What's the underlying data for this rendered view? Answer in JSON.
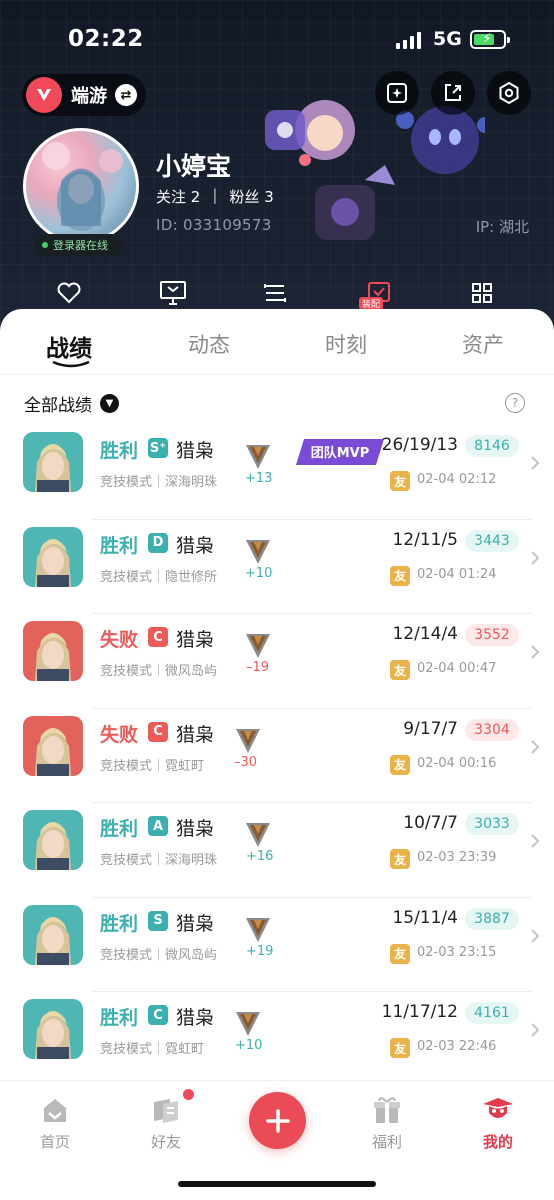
{
  "status": {
    "time": "02:22",
    "network": "5G"
  },
  "app": {
    "name": "端游"
  },
  "profile": {
    "name": "小婷宝",
    "follow_label": "关注",
    "follow_count": "2",
    "fans_label": "粉丝",
    "fans_count": "3",
    "id_text": "ID: 033109573",
    "ip_text": "IP: 湖北",
    "online_text": "登录器在线"
  },
  "quick": {
    "equip_tag": "装配"
  },
  "tabs": [
    "战绩",
    "动态",
    "时刻",
    "资产"
  ],
  "filter": {
    "label": "全部战绩",
    "help": "?"
  },
  "matches": [
    {
      "result": "胜利",
      "outcome": "win",
      "rank": "S⁺",
      "rank_color": "#3bb0ae",
      "hero": "猎枭",
      "mode": "竞技模式｜深海明珠",
      "delta": "+13",
      "kda": "26/19/13",
      "score": "8146",
      "date": "02-04 02:12",
      "mvp": "团队MVP"
    },
    {
      "result": "胜利",
      "outcome": "win",
      "rank": "D",
      "rank_color": "#3bb0ae",
      "hero": "猎枭",
      "mode": "竞技模式｜隐世修所",
      "delta": "+10",
      "kda": "12/11/5",
      "score": "3443",
      "date": "02-04 01:24"
    },
    {
      "result": "失败",
      "outcome": "lose",
      "rank": "C",
      "rank_color": "#ec5a5a",
      "hero": "猎枭",
      "mode": "竞技模式｜微风岛屿",
      "delta": "–19",
      "kda": "12/14/4",
      "score": "3552",
      "date": "02-04 00:47"
    },
    {
      "result": "失败",
      "outcome": "lose",
      "rank": "C",
      "rank_color": "#ec5a5a",
      "hero": "猎枭",
      "mode": "竞技模式｜霓虹町",
      "delta": "–30",
      "kda": "9/17/7",
      "score": "3304",
      "date": "02-04 00:16"
    },
    {
      "result": "胜利",
      "outcome": "win",
      "rank": "A",
      "rank_color": "#3bb0ae",
      "hero": "猎枭",
      "mode": "竞技模式｜深海明珠",
      "delta": "+16",
      "kda": "10/7/7",
      "score": "3033",
      "date": "02-03 23:39"
    },
    {
      "result": "胜利",
      "outcome": "win",
      "rank": "S",
      "rank_color": "#3bb0ae",
      "hero": "猎枭",
      "mode": "竞技模式｜微风岛屿",
      "delta": "+19",
      "kda": "15/11/4",
      "score": "3887",
      "date": "02-03 23:15"
    },
    {
      "result": "胜利",
      "outcome": "win",
      "rank": "C",
      "rank_color": "#3bb0ae",
      "hero": "猎枭",
      "mode": "竞技模式｜霓虹町",
      "delta": "+10",
      "kda": "11/17/12",
      "score": "4161",
      "date": "02-03 22:46"
    }
  ],
  "friend_tag": "友",
  "nav": [
    {
      "label": "首页",
      "icon": "home-icon"
    },
    {
      "label": "好友",
      "icon": "friends-icon"
    },
    {
      "label": "福利",
      "icon": "gift-icon"
    },
    {
      "label": "我的",
      "icon": "profile-icon"
    }
  ],
  "colors": {
    "accent": "#ea4b56",
    "win": "#3bb0ae",
    "lose": "#ec5a5a",
    "friend": "#e9b34a"
  }
}
